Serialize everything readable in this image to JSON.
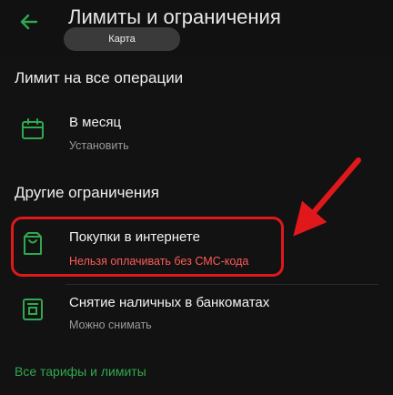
{
  "header": {
    "title": "Лимиты и ограничения",
    "chip_label": "Карта"
  },
  "limit_all": {
    "heading": "Лимит на все операции",
    "month_title": "В месяц",
    "month_sub": "Установить"
  },
  "other": {
    "heading": "Другие ограничения",
    "internet_title": "Покупки в интернете",
    "internet_sub": "Нельзя оплачивать без СМС-кода",
    "atm_title": "Снятие наличных в банкоматах",
    "atm_sub": "Можно снимать"
  },
  "footer": {
    "link": "Все тарифы и лимиты"
  },
  "colors": {
    "accent": "#2fa84f",
    "warning": "#ff5a5a",
    "annotation": "#e0181b",
    "background": "#121212"
  },
  "icons": {
    "back": "back-arrow-icon",
    "calendar": "calendar-icon",
    "bag": "shopping-bag-icon",
    "atm": "atm-icon"
  }
}
